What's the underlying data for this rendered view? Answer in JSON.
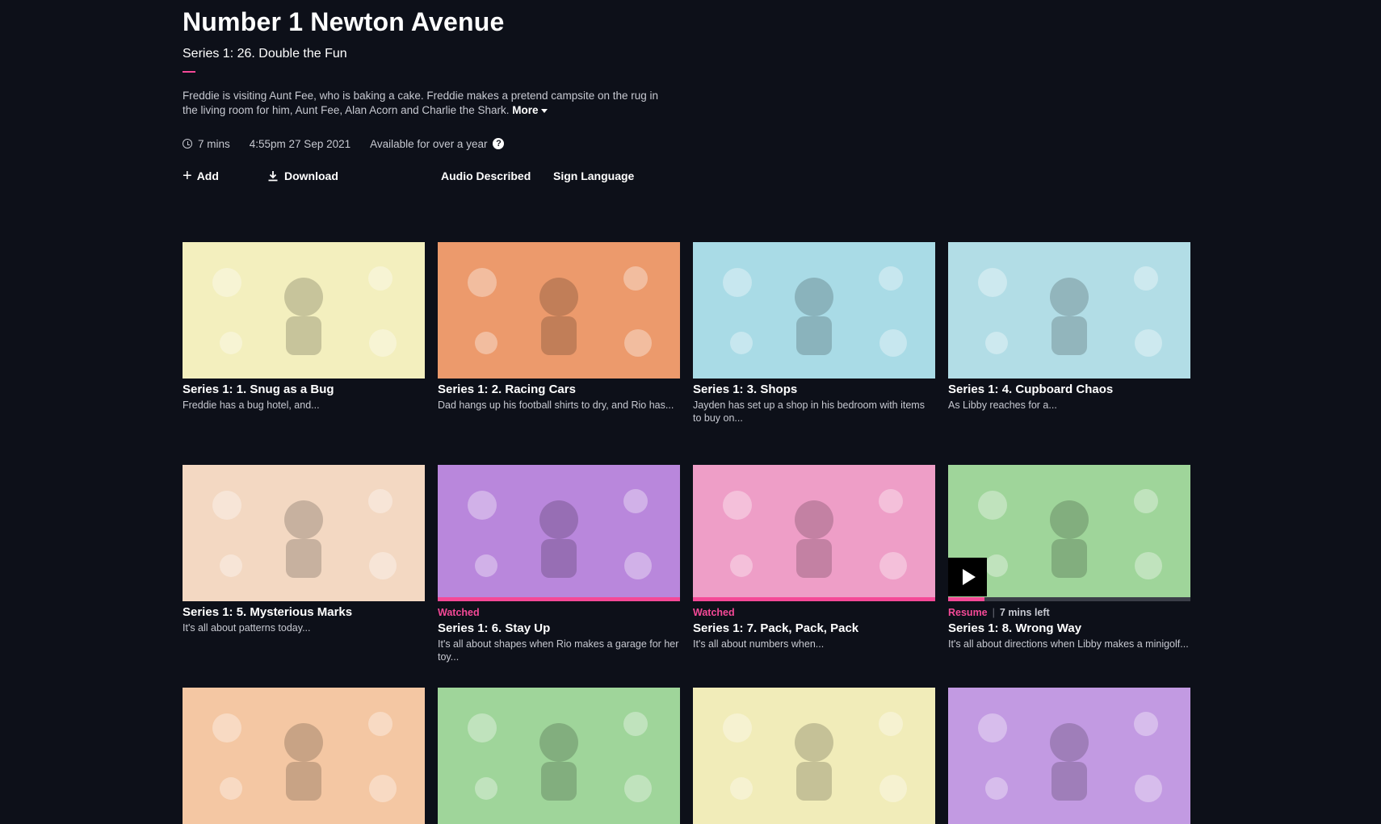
{
  "programme": {
    "title": "Number 1 Newton Avenue",
    "episode": "Series 1: 26. Double the Fun",
    "synopsis": "Freddie is visiting Aunt Fee, who is baking a cake. Freddie makes a pretend campsite on the rug in the living room for him, Aunt Fee, Alan Acorn and Charlie the Shark.",
    "more_label": "More",
    "duration": "7 mins",
    "broadcast": "4:55pm 27 Sep 2021",
    "availability": "Available for over a year",
    "help_glyph": "?"
  },
  "actions": {
    "add": "Add",
    "download": "Download",
    "audio_described": "Audio Described",
    "sign_language": "Sign Language"
  },
  "colors": {
    "accent": "#f54997",
    "background": "#0d1019",
    "muted_text": "#c7c9d1"
  },
  "episodes": [
    {
      "title": "Series 1: 1. Snug as a Bug",
      "desc": "Freddie has a bug hotel, and...",
      "status": "",
      "remaining": "",
      "progress": null,
      "thumb_color": "#f3efbe"
    },
    {
      "title": "Series 1: 2. Racing Cars",
      "desc": "Dad hangs up his football shirts to dry, and Rio has...",
      "status": "",
      "remaining": "",
      "progress": null,
      "thumb_color": "#ec9a6c"
    },
    {
      "title": "Series 1: 3. Shops",
      "desc": "Jayden has set up a shop in his bedroom with items to buy on...",
      "status": "",
      "remaining": "",
      "progress": null,
      "thumb_color": "#a9dbe6"
    },
    {
      "title": "Series 1: 4. Cupboard Chaos",
      "desc": "As Libby reaches for a...",
      "status": "",
      "remaining": "",
      "progress": null,
      "thumb_color": "#b2dde6"
    },
    {
      "title": "Series 1: 5. Mysterious Marks",
      "desc": "It's all about patterns today...",
      "status": "",
      "remaining": "",
      "progress": null,
      "thumb_color": "#f3d8c2"
    },
    {
      "title": "Series 1: 6. Stay Up",
      "desc": "It's all about shapes when Rio makes a garage for her toy...",
      "status": "Watched",
      "remaining": "",
      "progress": 1.0,
      "thumb_color": "#b987dc"
    },
    {
      "title": "Series 1: 7. Pack, Pack, Pack",
      "desc": "It's all about numbers when...",
      "status": "Watched",
      "remaining": "",
      "progress": 1.0,
      "thumb_color": "#ee9ec7"
    },
    {
      "title": "Series 1: 8. Wrong Way",
      "desc": "It's all about directions when Libby makes a minigolf...",
      "status": "Resume",
      "remaining": "7 mins left",
      "progress": 0.15,
      "thumb_color": "#9fd59a"
    },
    {
      "title": "",
      "desc": "",
      "status": "",
      "remaining": "",
      "progress": null,
      "thumb_color": "#f4c7a3"
    },
    {
      "title": "",
      "desc": "",
      "status": "",
      "remaining": "",
      "progress": null,
      "thumb_color": "#9fd59a"
    },
    {
      "title": "",
      "desc": "",
      "status": "",
      "remaining": "",
      "progress": null,
      "thumb_color": "#f1ecb9"
    },
    {
      "title": "",
      "desc": "",
      "status": "",
      "remaining": "",
      "progress": null,
      "thumb_color": "#c29ae2"
    }
  ]
}
